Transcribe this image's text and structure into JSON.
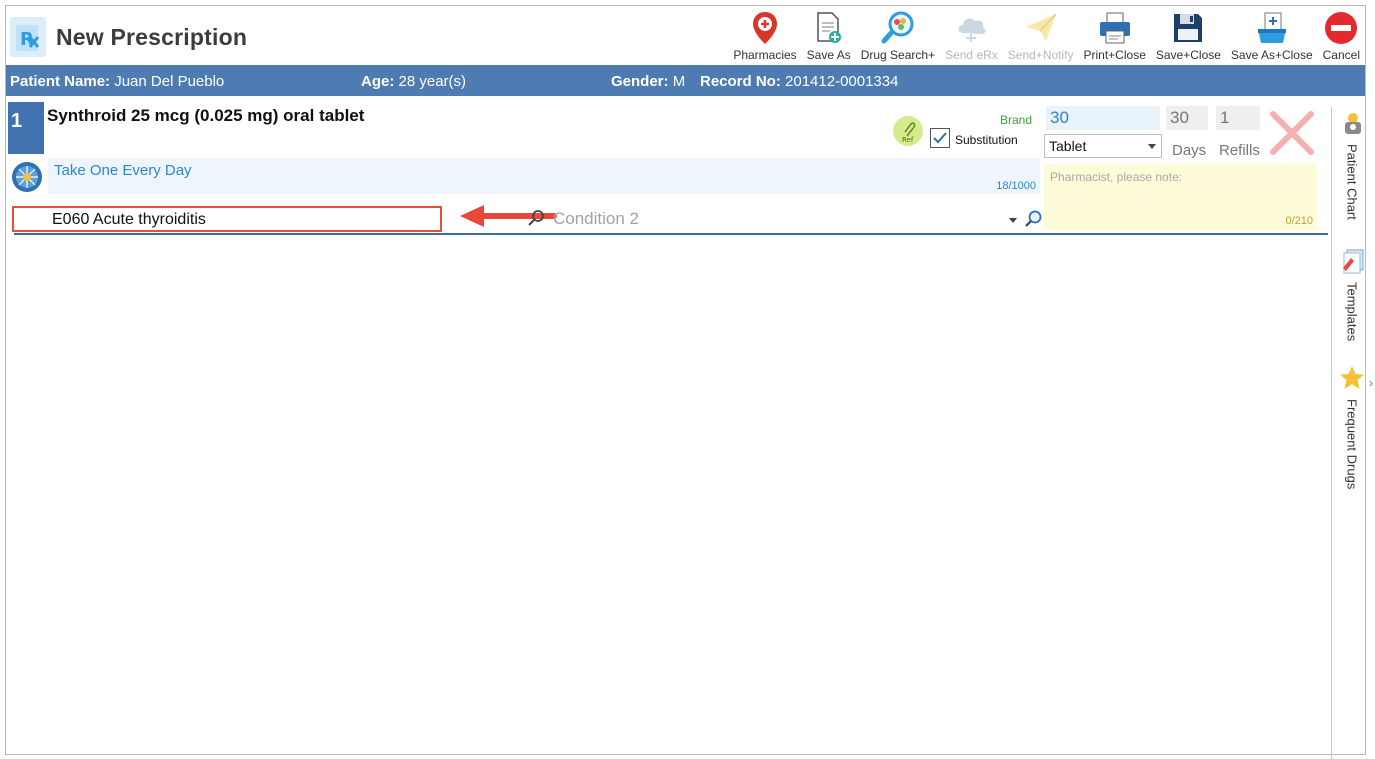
{
  "header": {
    "title": "New Prescription",
    "toolbar": [
      {
        "id": "pharmacies",
        "label": "Pharmacies",
        "icon": "map-pin-icon",
        "disabled": false
      },
      {
        "id": "save-as",
        "label": "Save As",
        "icon": "document-add-icon",
        "disabled": false
      },
      {
        "id": "drug-search",
        "label": "Drug Search+",
        "icon": "magnifier-pills-icon",
        "disabled": false
      },
      {
        "id": "send-erx",
        "label": "Send eRx",
        "icon": "cloud-icon",
        "disabled": true
      },
      {
        "id": "send-notify",
        "label": "Send+Notify",
        "icon": "paper-plane-icon",
        "disabled": true
      },
      {
        "id": "print-close",
        "label": "Print+Close",
        "icon": "printer-icon",
        "disabled": false
      },
      {
        "id": "save-close",
        "label": "Save+Close",
        "icon": "floppy-disk-icon",
        "disabled": false
      },
      {
        "id": "save-as-close",
        "label": "Save As+Close",
        "icon": "document-stack-icon",
        "disabled": false
      },
      {
        "id": "cancel",
        "label": "Cancel",
        "icon": "no-entry-icon",
        "disabled": false
      }
    ]
  },
  "patient": {
    "name_label": "Patient Name:",
    "name": "Juan Del Pueblo",
    "age_label": "Age:",
    "age": "28 year(s)",
    "gender_label": "Gender:",
    "gender": "M",
    "record_label": "Record No:",
    "record": "201412-0001334"
  },
  "rx": {
    "number": "1",
    "drug": "Synthroid 25 mcg (0.025 mg) oral tablet",
    "ref_label": "Ref",
    "brand_label": "Brand",
    "substitution_label": "Substitution",
    "substitution_checked": true,
    "quantity": "30",
    "days": "30",
    "refills": "1",
    "unit": "Tablet",
    "days_label": "Days",
    "refills_label": "Refills",
    "sig": "Take One Every Day",
    "sig_count": "18/1000",
    "note_placeholder": "Pharmacist, please note:",
    "note_count": "0/210",
    "condition1": "E060 Acute thyroiditis",
    "condition2_placeholder": "Condition 2"
  },
  "side_panel": [
    {
      "label": "Patient Chart",
      "icon": "patient-chart-icon"
    },
    {
      "label": "Templates",
      "icon": "templates-icon"
    },
    {
      "label": "Frequent Drugs",
      "icon": "star-icon"
    }
  ],
  "colors": {
    "accent": "#4e7cb2",
    "row_number": "#3f72ae",
    "sig_text": "#2a87d0",
    "highlight": "#e0513f",
    "brand": "#3aa03a",
    "note_bg": "#fdfbd8"
  }
}
